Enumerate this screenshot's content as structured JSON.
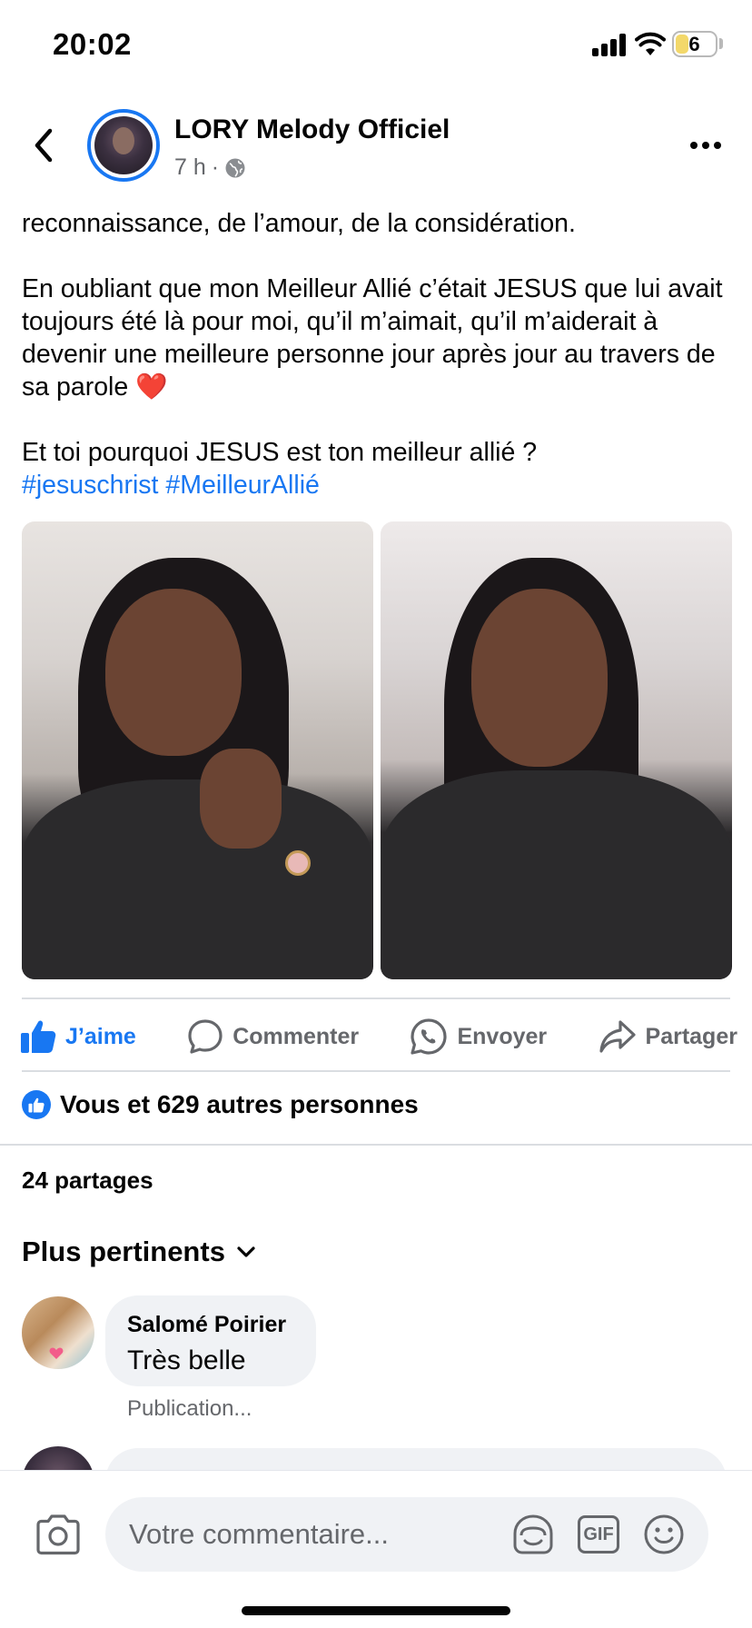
{
  "status_bar": {
    "time": "20:02",
    "battery": "6"
  },
  "post": {
    "page_name": "LORY Melody Officiel",
    "time_ago": "7 h",
    "meta_separator": "·",
    "text_line1": "reconnaissance, de l’amour, de la considération.",
    "text_para2": "En oubliant que mon Meilleur Allié c’était JESUS que lui avait toujours été là pour moi, qu’il m’aimait, qu’il m’aiderait à devenir une meilleure personne jour après jour au travers de sa parole",
    "heart_emoji": "❤️",
    "text_question": "Et toi pourquoi JESUS est ton meilleur allié ?",
    "hashtag1": "#jesuschrist",
    "hashtag2": "#MeilleurAllié"
  },
  "actions": {
    "like": "J’aime",
    "comment": "Commenter",
    "send": "Envoyer",
    "share": "Partager"
  },
  "reactions_text": "Vous et 629 autres personnes",
  "shares_text": "24 partages",
  "sort_label": "Plus pertinents",
  "comments": [
    {
      "author": "Salomé Poirier",
      "text": "Très belle",
      "meta": "Publication..."
    }
  ],
  "composer": {
    "placeholder": "Votre commentaire...",
    "gif_label": "GIF"
  },
  "colors": {
    "brand": "#1877f2",
    "secondary_text": "#65676b",
    "bubble": "#f0f2f5"
  }
}
